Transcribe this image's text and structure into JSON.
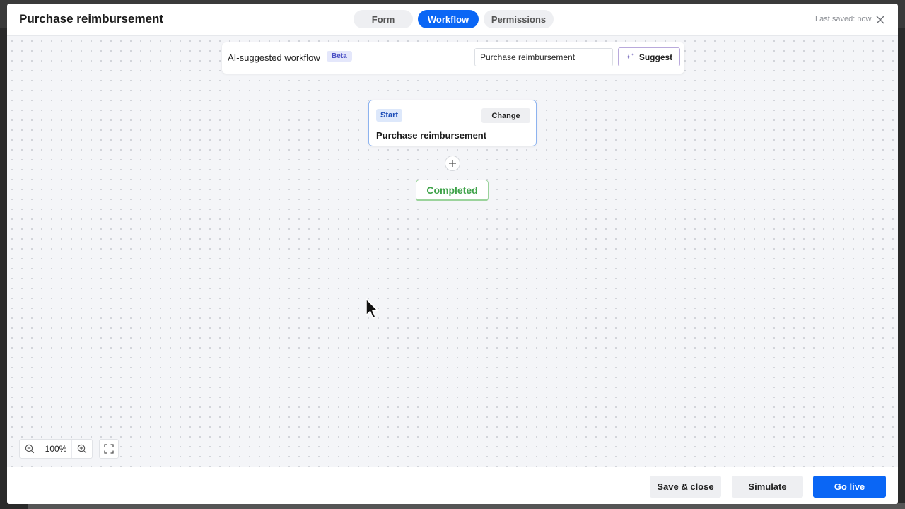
{
  "header": {
    "title": "Purchase reimbursement",
    "tabs": [
      {
        "label": "Form",
        "active": false
      },
      {
        "label": "Workflow",
        "active": true
      },
      {
        "label": "Permissions",
        "active": false
      }
    ],
    "last_saved": "Last saved: now"
  },
  "ai_bar": {
    "label": "AI-suggested workflow",
    "badge": "Beta",
    "input_value": "Purchase reimbursement",
    "suggest_label": "Suggest"
  },
  "workflow": {
    "start_node": {
      "badge": "Start",
      "change_label": "Change",
      "title": "Purchase reimbursement"
    },
    "end_node": {
      "label": "Completed"
    }
  },
  "zoom": {
    "level": "100%"
  },
  "footer": {
    "save_close_label": "Save & close",
    "simulate_label": "Simulate",
    "go_live_label": "Go live"
  },
  "colors": {
    "accent": "#0a66f5",
    "completed": "#3fa34a",
    "beta_badge": "#4a4fc4"
  },
  "icons": [
    "close-icon",
    "sparkle-icon",
    "plus-icon",
    "zoom-out-icon",
    "zoom-in-icon",
    "fit-screen-icon",
    "cursor-icon"
  ]
}
